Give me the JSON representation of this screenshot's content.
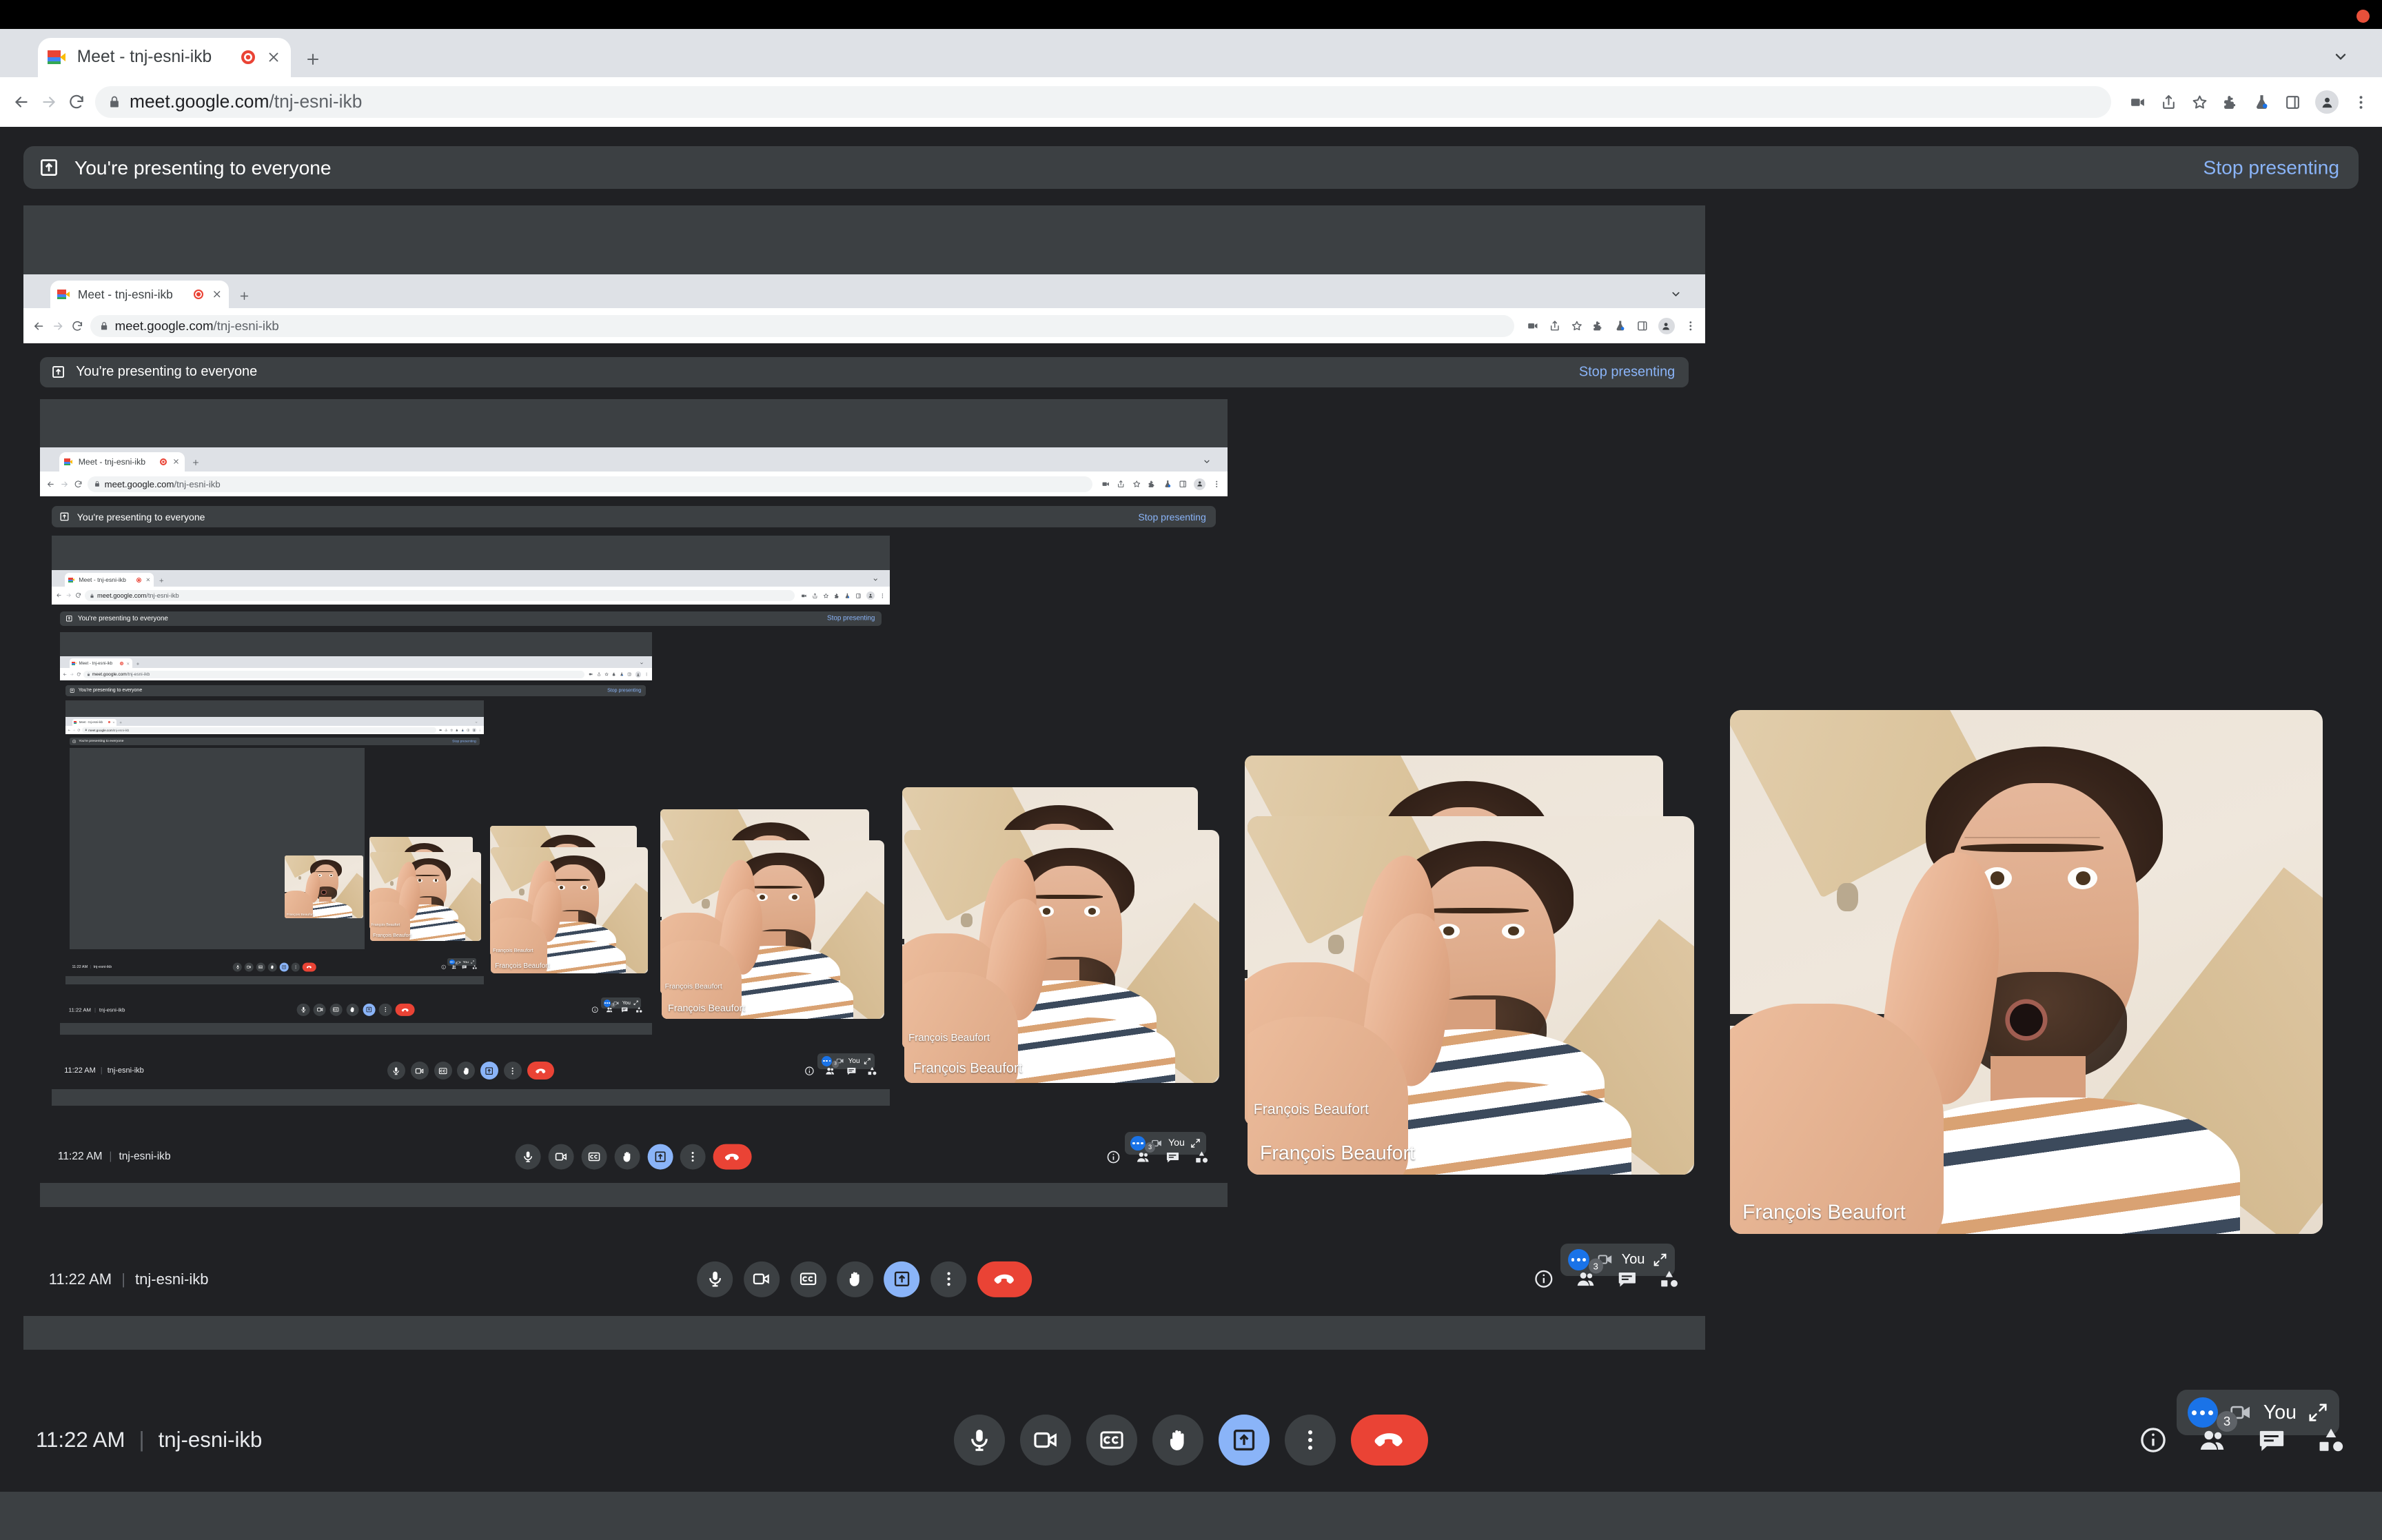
{
  "window": {
    "recording_indicator": "recording-dot"
  },
  "browser": {
    "tab": {
      "title": "Meet - tnj-esni-ikb",
      "favicon": "google-meet-favicon",
      "recording_icon": "tab-recording-icon",
      "close_icon": "×",
      "new_tab_icon": "+"
    },
    "tabstrip_chevron": "⌄",
    "nav": {
      "back": "←",
      "forward": "→",
      "reload": "⟳"
    },
    "omnibox": {
      "lock_icon": "lock-icon",
      "url_host": "meet.google.com",
      "url_path": "/tnj-esni-ikb"
    },
    "toolbar_icons": [
      "media-cast-icon",
      "share-icon",
      "bookmark-star-icon",
      "extensions-puzzle-icon",
      "experiments-flask-icon",
      "side-panel-icon",
      "profile-avatar-icon",
      "kebab-menu-icon"
    ]
  },
  "meet": {
    "banner": {
      "icon": "present-to-everyone-icon",
      "text": "You're presenting to everyone",
      "stop_label": "Stop presenting"
    },
    "statusbar": {
      "time": "11:22 AM",
      "separator": "|",
      "meeting_code": "tnj-esni-ikb"
    },
    "controls": [
      {
        "name": "microphone",
        "icon": "mic-icon",
        "state": "default"
      },
      {
        "name": "camera",
        "icon": "camera-icon",
        "state": "default"
      },
      {
        "name": "captions",
        "icon": "cc-icon",
        "state": "default"
      },
      {
        "name": "raise-hand",
        "icon": "hand-icon",
        "state": "default"
      },
      {
        "name": "present-now",
        "icon": "present-icon",
        "state": "active"
      },
      {
        "name": "more-options",
        "icon": "kebab-icon",
        "state": "default"
      },
      {
        "name": "leave-call",
        "icon": "hangup-icon",
        "state": "hangup"
      }
    ],
    "right_icons": [
      {
        "name": "meeting-details",
        "icon": "info-icon",
        "badge": null
      },
      {
        "name": "show-everyone",
        "icon": "people-icon",
        "badge": "3"
      },
      {
        "name": "chat",
        "icon": "chat-icon",
        "badge": null
      },
      {
        "name": "activities",
        "icon": "activities-icon",
        "badge": null
      }
    ],
    "self_pill": {
      "more_icon": "blue-more-dots-icon",
      "camera_icon": "camera-outline-icon",
      "label": "You",
      "expand_icon": "expand-arrows-icon"
    },
    "participants": [
      {
        "name": "François Beaufort"
      },
      {
        "name": "François Beaufort"
      },
      {
        "name": "François Beaufort"
      },
      {
        "name": "François Beaufort"
      },
      {
        "name": "François Beaufort"
      },
      {
        "name": "François Beaufort"
      },
      {
        "name": "François Beaufort"
      }
    ]
  },
  "colors": {
    "accent_blue": "#8ab4f8",
    "link_blue": "#8ab4f8",
    "hangup_red": "#ea4335",
    "meet_bg": "#202124",
    "surface": "#3c4043",
    "chrome_tabstrip": "#dee1e6",
    "chrome_toolbar": "#ffffff",
    "recording_red": "#e8503a"
  },
  "recursion": {
    "levels": 6,
    "description": "Nested screen share of the same Google Meet window (Droste effect)"
  }
}
